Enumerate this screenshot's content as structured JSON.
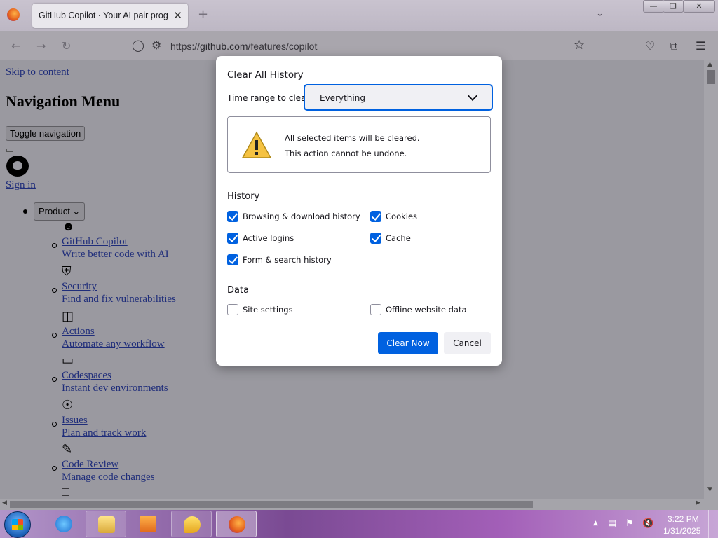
{
  "browser": {
    "tab_title": "GitHub Copilot · Your AI pair programmer",
    "tab_close": "✕",
    "new_tab": "+",
    "url_prefix": "https://",
    "url_host": "github.com",
    "url_path": "/features/copilot"
  },
  "page": {
    "skip_link": "Skip to content",
    "nav_heading": "Navigation Menu",
    "toggle_nav": "Toggle navigation",
    "sign_in": "Sign in",
    "product_button": "Product",
    "menu_items": [
      {
        "icon": "copilot-icon",
        "title": "GitHub Copilot",
        "desc": "Write better code with AI"
      },
      {
        "icon": "shield-check-icon",
        "title": "Security",
        "desc": "Find and fix vulnerabilities"
      },
      {
        "icon": "workflow-icon",
        "title": "Actions",
        "desc": "Automate any workflow"
      },
      {
        "icon": "codespaces-icon",
        "title": "Codespaces",
        "desc": "Instant dev environments"
      },
      {
        "icon": "issue-icon",
        "title": "Issues",
        "desc": "Plan and track work"
      },
      {
        "icon": "code-review-icon",
        "title": "Code Review",
        "desc": "Manage code changes"
      }
    ]
  },
  "dialog": {
    "title": "Clear All History",
    "time_range_label": "Time range to clear:",
    "time_range_value": "Everything",
    "warning_line1": "All selected items will be cleared.",
    "warning_line2": "This action cannot be undone.",
    "history_title": "History",
    "data_title": "Data",
    "checkboxes": {
      "browsing": {
        "label": "Browsing & download history",
        "checked": true
      },
      "cookies": {
        "label": "Cookies",
        "checked": true
      },
      "logins": {
        "label": "Active logins",
        "checked": true
      },
      "cache": {
        "label": "Cache",
        "checked": true
      },
      "forms": {
        "label": "Form & search history",
        "checked": true
      },
      "site_settings": {
        "label": "Site settings",
        "checked": false
      },
      "offline": {
        "label": "Offline website data",
        "checked": false
      }
    },
    "clear_now": "Clear Now",
    "cancel": "Cancel"
  },
  "taskbar": {
    "time": "3:22 PM",
    "date": "1/31/2025"
  },
  "colors": {
    "accent": "#0061e0",
    "dialog_bg": "#ffffff",
    "overlay": "#9a99a0"
  }
}
